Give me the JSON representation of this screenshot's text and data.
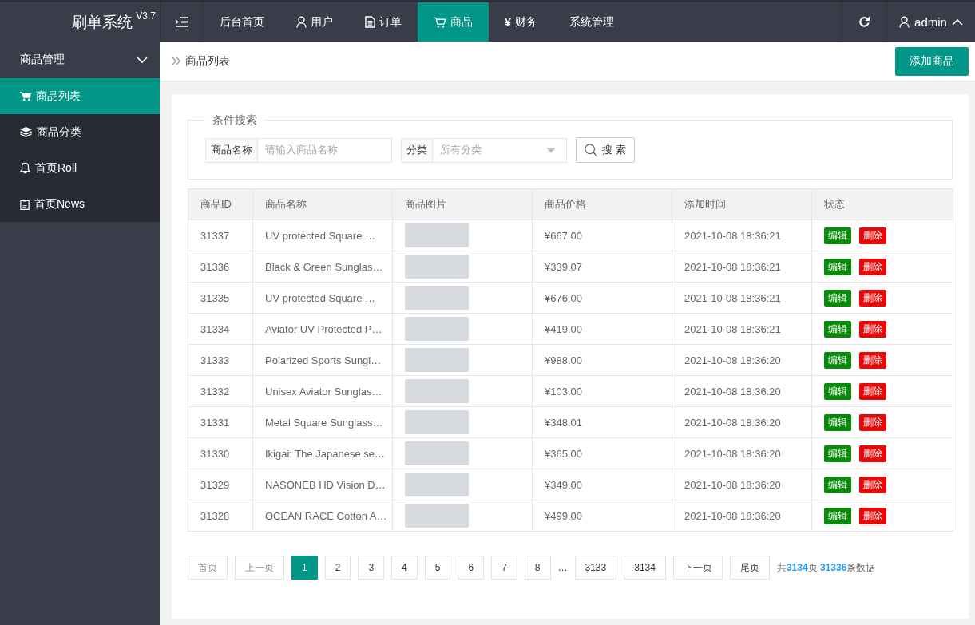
{
  "app": {
    "title": "刷单系统",
    "version": "V3.7"
  },
  "top_nav": [
    {
      "label": "后台首页",
      "selected": false
    },
    {
      "label": "用户",
      "selected": false
    },
    {
      "label": "订单",
      "selected": false
    },
    {
      "label": "商品",
      "selected": true
    },
    {
      "glyph": "¥",
      "label": "财务",
      "selected": false
    },
    {
      "label": "系统管理",
      "selected": false
    }
  ],
  "user_menu": {
    "username": "admin",
    "expanded": true
  },
  "sidebar": {
    "group": {
      "label": "商品管理",
      "expanded": true
    },
    "items": [
      {
        "label": "商品列表",
        "selected": true
      },
      {
        "label": "商品分类",
        "selected": false
      },
      {
        "label": "首页Roll",
        "selected": false
      },
      {
        "label": "首页News",
        "selected": false
      }
    ]
  },
  "breadcrumb": {
    "current": "商品列表"
  },
  "add_button": "添加商品",
  "search": {
    "legend": "条件搜索",
    "fields": [
      {
        "kind": "text",
        "label": "商品名称",
        "placeholder": "请输入商品名称"
      },
      {
        "kind": "select",
        "label": "分类",
        "placeholder": "所有分类"
      }
    ],
    "button": "搜 索"
  },
  "table": {
    "columns": [
      "商品ID",
      "商品名称",
      "商品图片",
      "商品价格",
      "添加时间",
      "状态"
    ],
    "rows": [
      {
        "id": "31337",
        "name": "UV protected Square …",
        "price": "¥667.00",
        "added": "2021-10-08 18:36:21",
        "actions": [
          {
            "kind": "edit",
            "label": "编辑"
          },
          {
            "kind": "delete",
            "label": "删除"
          }
        ]
      },
      {
        "id": "31336",
        "name": "Black & Green Sunglas…",
        "price": "¥339.07",
        "added": "2021-10-08 18:36:21",
        "actions": [
          {
            "kind": "edit",
            "label": "编辑"
          },
          {
            "kind": "delete",
            "label": "删除"
          }
        ]
      },
      {
        "id": "31335",
        "name": "UV protected Square …",
        "price": "¥676.00",
        "added": "2021-10-08 18:36:21",
        "actions": [
          {
            "kind": "edit",
            "label": "编辑"
          },
          {
            "kind": "delete",
            "label": "删除"
          }
        ]
      },
      {
        "id": "31334",
        "name": "Aviator UV Protected P…",
        "price": "¥419.00",
        "added": "2021-10-08 18:36:21",
        "actions": [
          {
            "kind": "edit",
            "label": "编辑"
          },
          {
            "kind": "delete",
            "label": "删除"
          }
        ]
      },
      {
        "id": "31333",
        "name": "Polarized Sports Sungl…",
        "price": "¥988.00",
        "added": "2021-10-08 18:36:20",
        "actions": [
          {
            "kind": "edit",
            "label": "编辑"
          },
          {
            "kind": "delete",
            "label": "删除"
          }
        ]
      },
      {
        "id": "31332",
        "name": "Unisex Aviator Sunglas…",
        "price": "¥103.00",
        "added": "2021-10-08 18:36:20",
        "actions": [
          {
            "kind": "edit",
            "label": "编辑"
          },
          {
            "kind": "delete",
            "label": "删除"
          }
        ]
      },
      {
        "id": "31331",
        "name": "Metal Square Sunglass…",
        "price": "¥348.01",
        "added": "2021-10-08 18:36:20",
        "actions": [
          {
            "kind": "edit",
            "label": "编辑"
          },
          {
            "kind": "delete",
            "label": "删除"
          }
        ]
      },
      {
        "id": "31330",
        "name": "Ikigai: The Japanese se…",
        "price": "¥365.00",
        "added": "2021-10-08 18:36:20",
        "actions": [
          {
            "kind": "edit",
            "label": "编辑"
          },
          {
            "kind": "delete",
            "label": "删除"
          }
        ]
      },
      {
        "id": "31329",
        "name": "NASONEB HD Vision D…",
        "price": "¥349.00",
        "added": "2021-10-08 18:36:20",
        "actions": [
          {
            "kind": "edit",
            "label": "编辑"
          },
          {
            "kind": "delete",
            "label": "删除"
          }
        ]
      },
      {
        "id": "31328",
        "name": "OCEAN RACE Cotton A…",
        "price": "¥499.00",
        "added": "2021-10-08 18:36:20",
        "actions": [
          {
            "kind": "edit",
            "label": "编辑"
          },
          {
            "kind": "delete",
            "label": "删除"
          }
        ]
      }
    ]
  },
  "pagination": {
    "first": {
      "label": "首页",
      "disabled": true
    },
    "prev": {
      "label": "上一页",
      "disabled": true
    },
    "pages": [
      {
        "label": "1",
        "selected": true
      },
      {
        "label": "2",
        "selected": false
      },
      {
        "label": "3",
        "selected": false
      },
      {
        "label": "4",
        "selected": false
      },
      {
        "label": "5",
        "selected": false
      },
      {
        "label": "6",
        "selected": false
      },
      {
        "label": "7",
        "selected": false
      },
      {
        "label": "8",
        "selected": false
      }
    ],
    "ellipsis": "…",
    "end_pages": [
      {
        "label": "3133",
        "selected": false
      },
      {
        "label": "3134",
        "selected": false
      }
    ],
    "next": {
      "label": "下一页",
      "disabled": false
    },
    "last": {
      "label": "尾页",
      "disabled": false
    },
    "summary": "共**3134**页 **31336**条数据"
  }
}
